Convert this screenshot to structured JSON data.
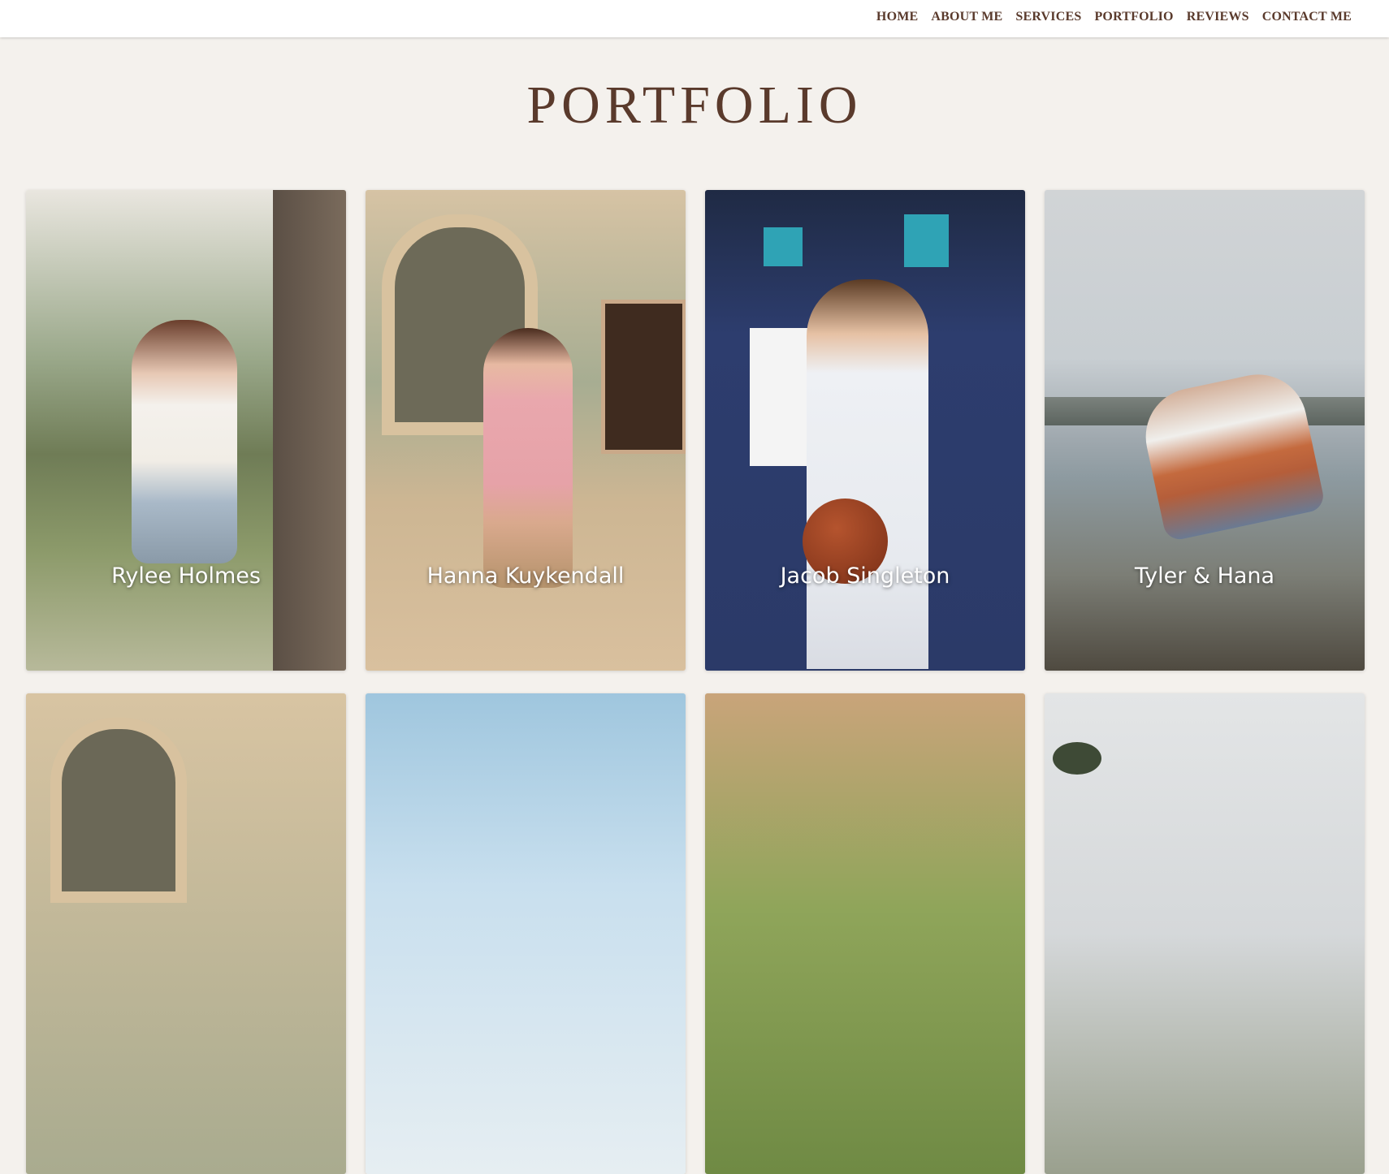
{
  "nav": {
    "items": [
      {
        "label": "HOME"
      },
      {
        "label": "ABOUT ME"
      },
      {
        "label": "SERVICES"
      },
      {
        "label": "PORTFOLIO"
      },
      {
        "label": "REVIEWS"
      },
      {
        "label": "CONTACT ME"
      }
    ]
  },
  "page": {
    "title": "PORTFOLIO"
  },
  "portfolio": {
    "cards": [
      {
        "label": "Rylee Holmes"
      },
      {
        "label": "Hanna Kuykendall"
      },
      {
        "label": "Jacob Singleton"
      },
      {
        "label": "Tyler & Hana"
      },
      {
        "label": ""
      },
      {
        "label": ""
      },
      {
        "label": ""
      },
      {
        "label": ""
      }
    ]
  },
  "colors": {
    "brand_text": "#5a3a2c",
    "background": "#f4f1ed",
    "header_bg": "#ffffff"
  }
}
